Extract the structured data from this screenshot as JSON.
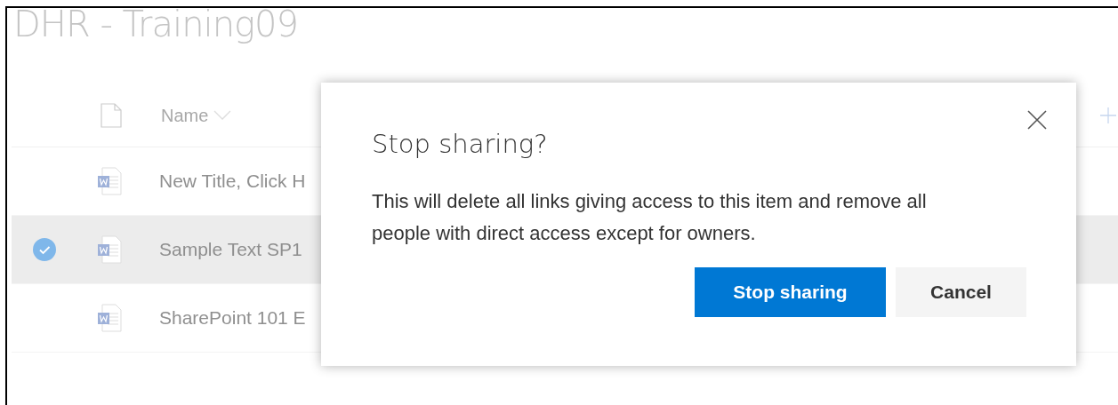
{
  "page": {
    "title": "DHR - Training09"
  },
  "list": {
    "columns": [
      {
        "label": "Name"
      }
    ],
    "rows": [
      {
        "name": "New Title, Click H",
        "selected": false
      },
      {
        "name": "Sample Text SP1",
        "selected": true
      },
      {
        "name": "SharePoint 101 E",
        "selected": false
      }
    ]
  },
  "dialog": {
    "title": "Stop sharing?",
    "message": "This will delete all links giving access to this item and remove all people with direct access except for owners.",
    "buttons": [
      {
        "label": "Stop sharing",
        "kind": "primary"
      },
      {
        "label": "Cancel",
        "kind": "secondary"
      }
    ]
  }
}
